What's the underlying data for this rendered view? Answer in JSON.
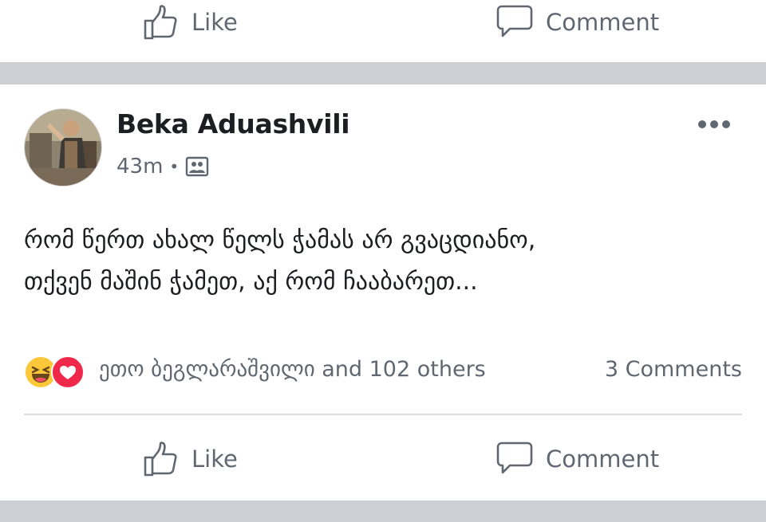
{
  "top_actions": {
    "like_label": "Like",
    "comment_label": "Comment"
  },
  "post": {
    "author": "Beka Aduashvili",
    "time": "43m",
    "privacy_icon": "group-photo-icon",
    "text_line1": "რომ წერთ ახალ წელს ჭამას არ გვაცდიანო,",
    "text_line2": "თქვენ მაშინ ჭამეთ, აქ რომ ჩააბარეთ...",
    "reactions": {
      "icons": [
        "haha-reaction-icon",
        "love-reaction-icon"
      ],
      "summary": "ეთო ბეგლარაშვილი and 102 others"
    },
    "comments_count": "3 Comments"
  },
  "bottom_actions": {
    "like_label": "Like",
    "comment_label": "Comment"
  },
  "colors": {
    "separator": "#ccd0d5",
    "secondary_text": "#606770",
    "love": "#f0284a",
    "haha": "#fcc83a"
  }
}
